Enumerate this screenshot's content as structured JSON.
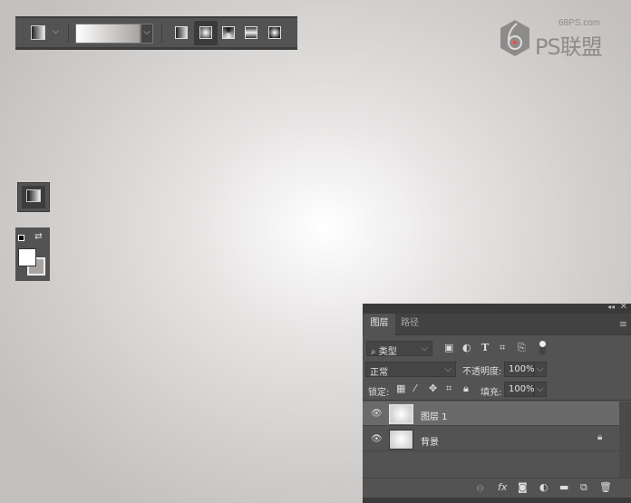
{
  "toolbar": {
    "tool": "gradient-tool",
    "gradient_preset": "white-to-gray",
    "gradient_types": [
      "linear",
      "radial",
      "angle",
      "reflected",
      "diamond"
    ],
    "active_type": "radial"
  },
  "watermark": {
    "site": "68PS.com",
    "name": "PS联盟"
  },
  "panel": {
    "tabs": [
      {
        "label": "图层",
        "active": true
      },
      {
        "label": "路径",
        "active": false
      }
    ],
    "filter_label": "类型",
    "blend_mode": "正常",
    "opacity_label": "不透明度:",
    "opacity_value": "100%",
    "lock_label": "锁定:",
    "fill_label": "填充:",
    "fill_value": "100%",
    "layers": [
      {
        "name": "图层 1",
        "selected": true,
        "visible": true,
        "locked": false
      },
      {
        "name": "背景",
        "selected": false,
        "visible": true,
        "locked": true
      }
    ]
  },
  "colors": {
    "foreground": "#ffffff",
    "background": "#a8a4a0"
  }
}
